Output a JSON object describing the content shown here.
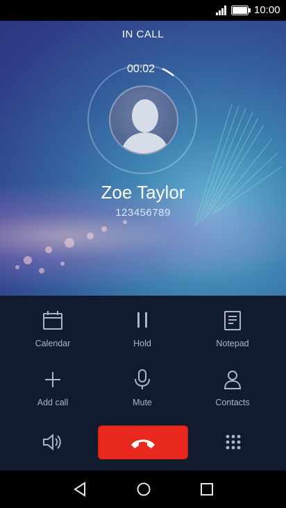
{
  "status_bar": {
    "time": "10:00"
  },
  "call": {
    "state": "IN CALL",
    "timer": "00:02",
    "name": "Zoe Taylor",
    "number": "123456789"
  },
  "controls": {
    "calendar": "Calendar",
    "hold": "Hold",
    "notepad": "Notepad",
    "add_call": "Add call",
    "mute": "Mute",
    "contacts": "Contacts"
  },
  "colors": {
    "end_call": "#e8281c",
    "panel": "#121a30"
  }
}
